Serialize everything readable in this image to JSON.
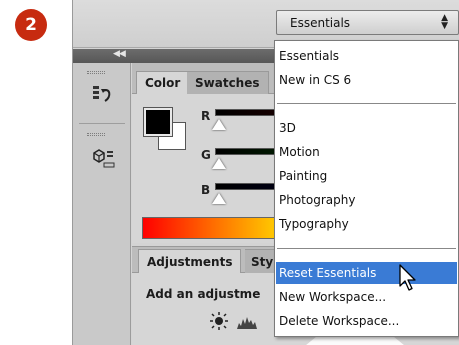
{
  "step": {
    "number": "2"
  },
  "options_bar": {
    "workspace_selected": "Essentials"
  },
  "color_panel": {
    "tabs": [
      "Color",
      "Swatches"
    ],
    "slider_labels": [
      "R",
      "G",
      "B"
    ],
    "colors": {
      "foreground": "#000000",
      "background": "#ffffff",
      "r_track": "#5a0000",
      "g_track": "#006000",
      "b_track": "#00004a"
    }
  },
  "adjustments_panel": {
    "tabs": [
      "Adjustments",
      "Sty"
    ],
    "hint": "Add an adjustme"
  },
  "workspace_menu": {
    "items": [
      {
        "label": "Essentials"
      },
      {
        "label": "New in CS 6"
      },
      {
        "label": "3D"
      },
      {
        "label": "Motion"
      },
      {
        "label": "Painting"
      },
      {
        "label": "Photography"
      },
      {
        "label": "Typography"
      },
      {
        "label": "Reset Essentials",
        "highlighted": true
      },
      {
        "label": "New Workspace..."
      },
      {
        "label": "Delete Workspace..."
      }
    ]
  },
  "theme": {
    "badge_color": "#c72b10",
    "highlight_color": "#3a7bd5"
  }
}
